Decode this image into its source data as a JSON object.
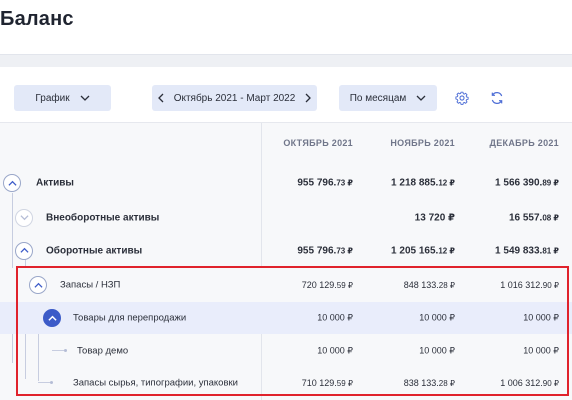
{
  "page": {
    "title": "Баланс"
  },
  "toolbar": {
    "chart_label": "График",
    "period_label": "Октябрь 2021 - Март 2022",
    "grouping_label": "По месяцам"
  },
  "colors": {
    "accent": "#3c5bc8",
    "button_bg": "#e3e9f8",
    "highlight": "#e9edfb",
    "frame": "#e0222c"
  },
  "table": {
    "columns": [
      "ОКТЯБРЬ 2021",
      "НОЯБРЬ 2021",
      "ДЕКАБРЬ 2021"
    ],
    "rows": [
      {
        "name": "Активы",
        "values": [
          [
            "955 796.",
            "73 ₽"
          ],
          [
            "1 218 885.",
            "12 ₽"
          ],
          [
            "1 566 390.",
            "89 ₽"
          ]
        ]
      },
      {
        "name": "Внеоборотные активы",
        "values": [
          [
            "",
            ""
          ],
          [
            "13 720 ₽",
            ""
          ],
          [
            "16 557.",
            "08 ₽"
          ]
        ]
      },
      {
        "name": "Оборотные активы",
        "values": [
          [
            "955 796.",
            "73 ₽"
          ],
          [
            "1 205 165.",
            "12 ₽"
          ],
          [
            "1 549 833.",
            "81 ₽"
          ]
        ]
      },
      {
        "name": "Запасы / НЗП",
        "values": [
          [
            "720 129.",
            "59 ₽"
          ],
          [
            "848 133.",
            "28 ₽"
          ],
          [
            "1 016 312.",
            "90 ₽"
          ]
        ]
      },
      {
        "name": "Товары для перепродажи",
        "values": [
          [
            "10 000 ₽",
            ""
          ],
          [
            "10 000 ₽",
            ""
          ],
          [
            "10 000 ₽",
            ""
          ]
        ]
      },
      {
        "name": "Товар демо",
        "values": [
          [
            "10 000 ₽",
            ""
          ],
          [
            "10 000 ₽",
            ""
          ],
          [
            "10 000 ₽",
            ""
          ]
        ]
      },
      {
        "name": "Запасы сырья, типографии, упаковки",
        "values": [
          [
            "710 129.",
            "59 ₽"
          ],
          [
            "838 133.",
            "28 ₽"
          ],
          [
            "1 006 312.",
            "90 ₽"
          ]
        ]
      }
    ]
  },
  "icons": [
    "chevron-down-icon",
    "chevron-left-icon",
    "chevron-right-icon",
    "gear-icon",
    "refresh-icon",
    "expand-toggle-icon"
  ]
}
